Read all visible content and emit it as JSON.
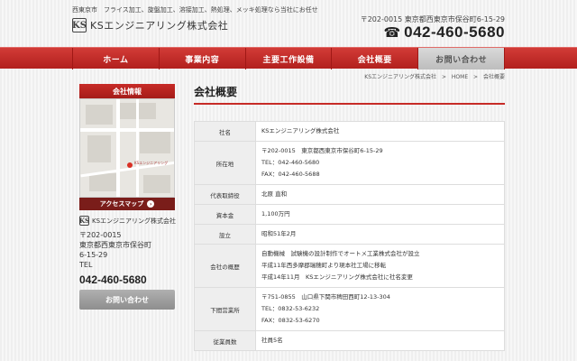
{
  "header": {
    "tagline": "西東京市　フライス加工、旋盤加工、溶接加工、熱処理、メッキ処理なら当社にお任せ",
    "company_name": "KSエンジニアリング株式会社",
    "logo_mark": "KS",
    "address": "〒202-0015 東京都西東京市保谷町6-15-29",
    "phone": "042-460-5680",
    "phone_icon": "phone-icon"
  },
  "nav": {
    "items": [
      {
        "label": "ホーム"
      },
      {
        "label": "事業内容"
      },
      {
        "label": "主要工作設備"
      },
      {
        "label": "会社概要"
      },
      {
        "label": "お問い合わせ"
      }
    ],
    "active_index": 4
  },
  "breadcrumb": {
    "items": [
      "KSエンジニアリング株式会社",
      "HOME",
      "会社概要"
    ],
    "separator": ">"
  },
  "sidebar": {
    "title": "会社情報",
    "map_label": "KSエンジニアリング",
    "access_button": "アクセスマップ",
    "company_name": "KSエンジニアリング株式会社",
    "postal": "〒202-0015",
    "address_line1": "東京都西東京市保谷町",
    "address_line2": "6-15-29",
    "tel_label": "TEL",
    "phone": "042-460-5680",
    "contact_button": "お問い合わせ"
  },
  "main": {
    "title": "会社概要",
    "rows": [
      {
        "label": "社名",
        "lines": [
          "KSエンジニアリング株式会社"
        ]
      },
      {
        "label": "所在地",
        "lines": [
          "〒202-0015　東京都西東京市保谷町6-15-29",
          "TEL：042-460-5680",
          "FAX：042-460-5688"
        ]
      },
      {
        "label": "代表取締役",
        "lines": [
          "北原 直和"
        ]
      },
      {
        "label": "資本金",
        "lines": [
          "1,100万円"
        ]
      },
      {
        "label": "設立",
        "lines": [
          "昭和51年2月"
        ]
      },
      {
        "label": "会社の概歴",
        "lines": [
          "自動機械　試験機の設計制作でオートメ工業株式会社が設立",
          "平成11年西多摩郡瑞穂町より現本社工場に移転",
          "平成14年11月　KSエンジニアリング株式会社に社名変更"
        ]
      },
      {
        "label": "下間営業所",
        "lines": [
          "〒751-0855　山口県下関市稗田西町12-13-304",
          "TEL：0832-53-6232",
          "FAX：0832-53-6270"
        ]
      },
      {
        "label": "従業員数",
        "lines": [
          "社員5名"
        ]
      }
    ]
  },
  "colors": {
    "accent": "#c72b27",
    "nav_active": "#c9c9c9"
  }
}
